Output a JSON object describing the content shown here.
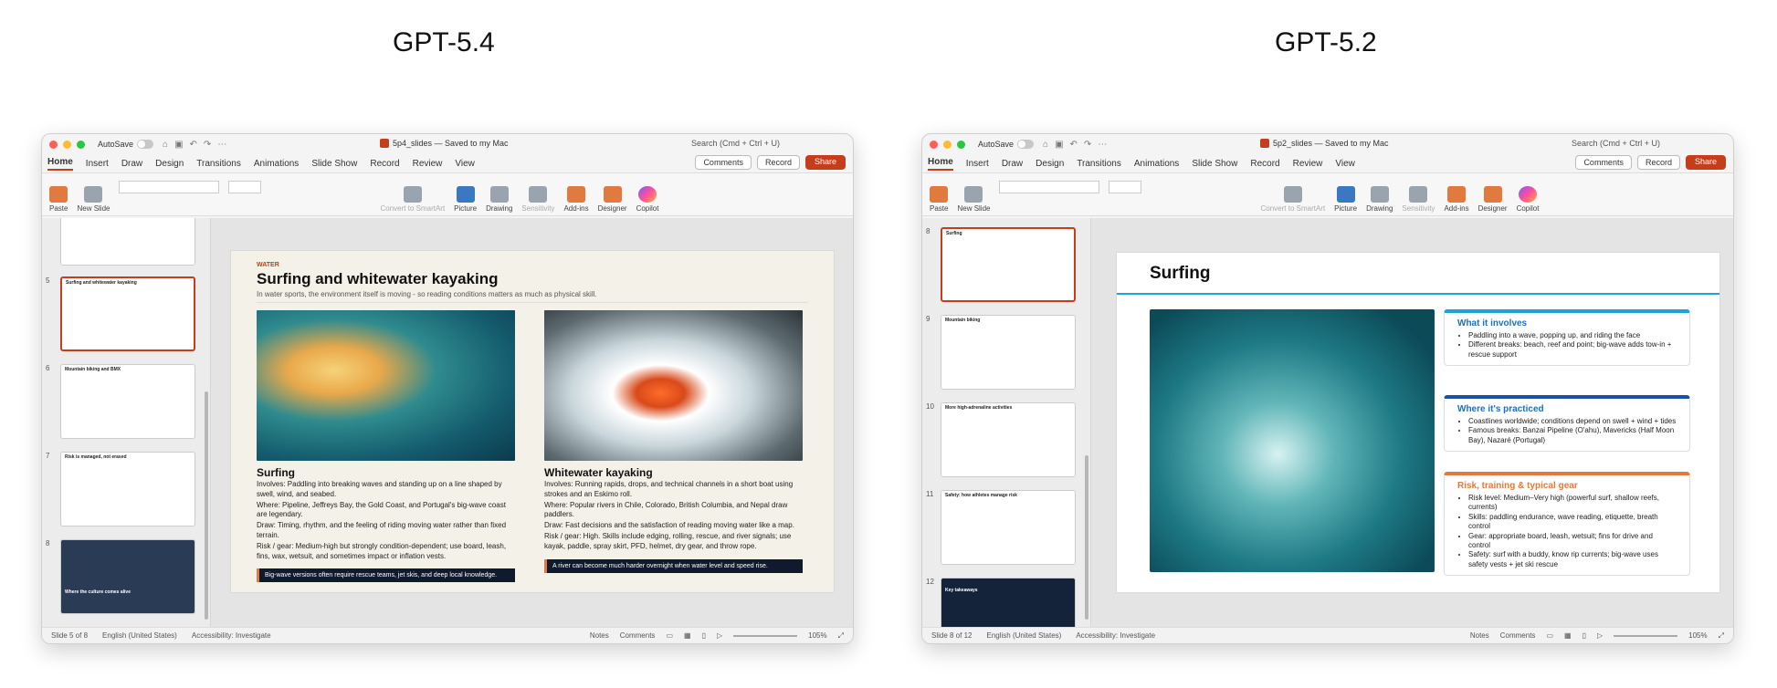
{
  "headings": {
    "left": "GPT-5.4",
    "right": "GPT-5.2"
  },
  "left": {
    "doc_title": "5p4_slides — Saved to my Mac",
    "slide_number_status": "Slide 5 of 8",
    "thumbs": [
      {
        "num": "",
        "title": ""
      },
      {
        "num": "5",
        "title": "Surfing and whitewater kayaking"
      },
      {
        "num": "6",
        "title": "Mountain biking and BMX"
      },
      {
        "num": "7",
        "title": "Risk is managed, not erased"
      },
      {
        "num": "8",
        "title": "Where the culture comes alive"
      }
    ],
    "slide": {
      "kicker": "WATER",
      "title": "Surfing and whitewater kayaking",
      "subtitle": "In water sports, the environment itself is moving - so reading conditions matters as much as physical skill.",
      "cols": [
        {
          "heading": "Surfing",
          "lines": [
            "Involves: Paddling into breaking waves and standing up on a line shaped by swell, wind, and seabed.",
            "Where: Pipeline, Jeffreys Bay, the Gold Coast, and Portugal's big-wave coast are legendary.",
            "Draw: Timing, rhythm, and the feeling of riding moving water rather than fixed terrain.",
            "Risk / gear: Medium-high but strongly condition-dependent; use board, leash, fins, wax, wetsuit, and sometimes impact or inflation vests."
          ],
          "bar": "Big-wave versions often require rescue teams, jet skis, and deep local knowledge."
        },
        {
          "heading": "Whitewater kayaking",
          "lines": [
            "Involves: Running rapids, drops, and technical channels in a short boat using strokes and an Eskimo roll.",
            "Where: Popular rivers in Chile, Colorado, British Columbia, and Nepal draw paddlers.",
            "Draw: Fast decisions and the satisfaction of reading moving water like a map.",
            "Risk / gear: High. Skills include edging, rolling, rescue, and river signals; use kayak, paddle, spray skirt, PFD, helmet, dry gear, and throw rope."
          ],
          "bar": "A river can become much harder overnight when water level and speed rise."
        }
      ]
    }
  },
  "right": {
    "doc_title": "5p2_slides — Saved to my Mac",
    "slide_number_status": "Slide 8 of 12",
    "thumbs": [
      {
        "num": "8",
        "title": "Surfing"
      },
      {
        "num": "9",
        "title": "Mountain biking"
      },
      {
        "num": "10",
        "title": "More high-adrenaline activities"
      },
      {
        "num": "11",
        "title": "Safety: how athletes manage risk"
      },
      {
        "num": "12",
        "title": "Key takeaways"
      }
    ],
    "slide": {
      "title": "Surfing",
      "cards": [
        {
          "heading": "What it involves",
          "items": [
            "Paddling into a wave, popping up, and riding the face",
            "Different breaks: beach, reef and point; big-wave adds tow-in + rescue support"
          ]
        },
        {
          "heading": "Where it's practiced",
          "items": [
            "Coastlines worldwide; conditions depend on swell + wind + tides",
            "Famous breaks: Banzai Pipeline (O'ahu), Mavericks (Half Moon Bay), Nazaré (Portugal)"
          ]
        },
        {
          "heading": "Risk, training & typical gear",
          "items": [
            "Risk level: Medium–Very high (powerful surf, shallow reefs, currents)",
            "Skills: paddling endurance, wave reading, etiquette, breath control",
            "Gear: appropriate board, leash, wetsuit; fins for drive and control",
            "Safety: surf with a buddy, know rip currents; big-wave uses safety vests + jet ski rescue"
          ]
        }
      ]
    }
  },
  "common": {
    "autosave": "AutoSave",
    "search": "Search (Cmd + Ctrl + U)",
    "tabs": [
      "Home",
      "Insert",
      "Draw",
      "Design",
      "Transitions",
      "Animations",
      "Slide Show",
      "Record",
      "Review",
      "View"
    ],
    "comments": "Comments",
    "record": "Record",
    "share": "Share",
    "ribbon": {
      "paste": "Paste",
      "new_slide": "New Slide",
      "convert": "Convert to SmartArt",
      "picture": "Picture",
      "drawing": "Drawing",
      "sensitivity": "Sensitivity",
      "addins": "Add-ins",
      "designer": "Designer",
      "copilot": "Copilot"
    },
    "language": "English (United States)",
    "accessibility": "Accessibility: Investigate",
    "notes": "Notes",
    "zoom": "105%"
  },
  "colors": {
    "accent": "#c43e1c",
    "share": "#c43e1c",
    "blue": "#1fa3d6",
    "orange": "#e07a3e"
  }
}
